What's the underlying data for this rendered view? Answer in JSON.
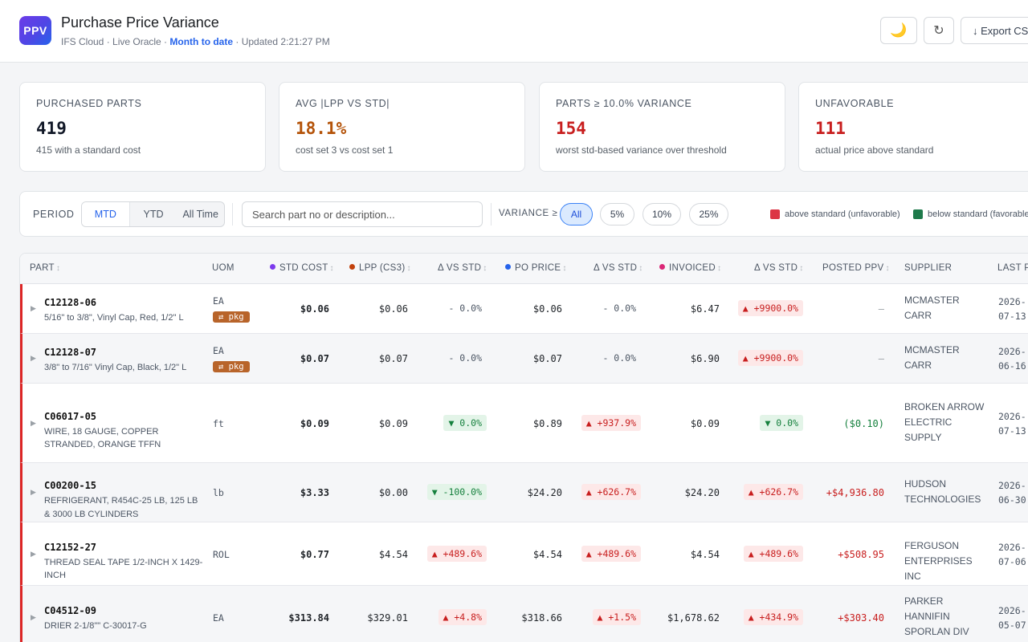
{
  "header": {
    "logo": "PPV",
    "title": "Purchase Price Variance",
    "sub_source": "IFS Cloud · Live Oracle · ",
    "sub_period": "Month to date",
    "sub_updated": " · Updated 2:21:27 PM",
    "theme_icon": "🌙",
    "refresh_icon": "↻",
    "export_label": "↓ Export CSV"
  },
  "kpis": [
    {
      "label": "PURCHASED PARTS",
      "value": "419",
      "sub": "415 with a standard cost",
      "color": "#111827"
    },
    {
      "label": "AVG |LPP VS STD|",
      "value": "18.1%",
      "sub": "cost set 3 vs cost set 1",
      "color": "#b45309"
    },
    {
      "label": "PARTS ≥ 10.0% VARIANCE",
      "value": "154",
      "sub": "worst std-based variance over threshold",
      "color": "#c81e1e"
    },
    {
      "label": "UNFAVORABLE",
      "value": "111",
      "sub": "actual price above standard",
      "color": "#c81e1e"
    }
  ],
  "filters": {
    "period_label": "PERIOD",
    "period_options": [
      "MTD",
      "YTD",
      "All Time"
    ],
    "period_selected": "MTD",
    "search_placeholder": "Search part no or description...",
    "variance_label": "VARIANCE ≥",
    "variance_options": [
      "All",
      "5%",
      "10%",
      "25%"
    ],
    "variance_selected": "All",
    "legend_unfav": "above standard (unfavorable)",
    "legend_fav": "below standard (favorable)",
    "legend_unfav_color": "#dc3545",
    "legend_fav_color": "#1e7a4b"
  },
  "table": {
    "headers": {
      "part": "PART",
      "uom": "UOM",
      "std_cost": "STD COST",
      "lpp": "LPP (CS3)",
      "d1": "Δ VS STD",
      "po_price": "PO PRICE",
      "d2": "Δ VS STD",
      "invoiced": "INVOICED",
      "d3": "Δ VS STD",
      "posted_ppv": "POSTED PPV",
      "supplier": "SUPPLIER",
      "last": "LAST P"
    },
    "sort_icon": "↕",
    "series_colors": {
      "std": "#7c3aed",
      "lpp": "#c2410c",
      "po": "#2563eb",
      "inv": "#db2777"
    },
    "rows": [
      {
        "part_no": "C12128-06",
        "desc": "5/16\" to 3/8\", Vinyl Cap, Red, 1/2\" L",
        "uom": "EA",
        "pkg": "⇄ pkg",
        "std": "$0.06",
        "lpp": "$0.06",
        "d1": "- 0.0%",
        "d1t": "flat",
        "po": "$0.06",
        "d2": "- 0.0%",
        "d2t": "flat",
        "inv": "$6.47",
        "d3": "▲ +9900.0%",
        "d3t": "up",
        "ppv": "–",
        "ppvt": "muted",
        "supplier": "MCMASTER CARR",
        "last": "2026-07-13"
      },
      {
        "part_no": "C12128-07",
        "desc": "3/8\" to 7/16\" Vinyl Cap, Black, 1/2\" L",
        "uom": "EA",
        "pkg": "⇄ pkg",
        "std": "$0.07",
        "lpp": "$0.07",
        "d1": "- 0.0%",
        "d1t": "flat",
        "po": "$0.07",
        "d2": "- 0.0%",
        "d2t": "flat",
        "inv": "$6.90",
        "d3": "▲ +9900.0%",
        "d3t": "up",
        "ppv": "–",
        "ppvt": "muted",
        "supplier": "MCMASTER CARR",
        "last": "2026-06-16"
      },
      {
        "part_no": "C06017-05",
        "desc": "WIRE, 18 GAUGE, COPPER STRANDED, ORANGE TFFN",
        "uom": "ft",
        "pkg": "",
        "std": "$0.09",
        "lpp": "$0.09",
        "d1": "▼ 0.0%",
        "d1t": "down",
        "po": "$0.89",
        "d2": "▲ +937.9%",
        "d2t": "up",
        "inv": "$0.09",
        "d3": "▼ 0.0%",
        "d3t": "down",
        "ppv": "($0.10)",
        "ppvt": "green",
        "supplier": "BROKEN ARROW ELECTRIC SUPPLY",
        "last": "2026-07-13"
      },
      {
        "part_no": "C00200-15",
        "desc": "REFRIGERANT, R454C-25 LB, 125 LB & 3000 LB CYLINDERS",
        "uom": "lb",
        "pkg": "",
        "std": "$3.33",
        "lpp": "$0.00",
        "d1": "▼ -100.0%",
        "d1t": "down",
        "po": "$24.20",
        "d2": "▲ +626.7%",
        "d2t": "up",
        "inv": "$24.20",
        "d3": "▲ +626.7%",
        "d3t": "up",
        "ppv": "+$4,936.80",
        "ppvt": "red",
        "supplier": "HUDSON TECHNOLOGIES",
        "last": "2026-06-30"
      },
      {
        "part_no": "C12152-27",
        "desc": "THREAD SEAL TAPE 1/2-INCH X 1429-INCH",
        "uom": "ROL",
        "pkg": "",
        "std": "$0.77",
        "lpp": "$4.54",
        "d1": "▲ +489.6%",
        "d1t": "up",
        "po": "$4.54",
        "d2": "▲ +489.6%",
        "d2t": "up",
        "inv": "$4.54",
        "d3": "▲ +489.6%",
        "d3t": "up",
        "ppv": "+$508.95",
        "ppvt": "red",
        "supplier": "FERGUSON ENTERPRISES INC",
        "last": "2026-07-06"
      },
      {
        "part_no": "C04512-09",
        "desc": "DRIER 2-1/8\"\" C-30017-G",
        "uom": "EA",
        "pkg": "",
        "std": "$313.84",
        "lpp": "$329.01",
        "d1": "▲ +4.8%",
        "d1t": "up",
        "po": "$318.66",
        "d2": "▲ +1.5%",
        "d2t": "up",
        "inv": "$1,678.62",
        "d3": "▲ +434.9%",
        "d3t": "up",
        "ppv": "+$303.40",
        "ppvt": "red",
        "supplier": "PARKER HANNIFIN SPORLAN DIV",
        "last": "2026-05-07"
      }
    ]
  }
}
